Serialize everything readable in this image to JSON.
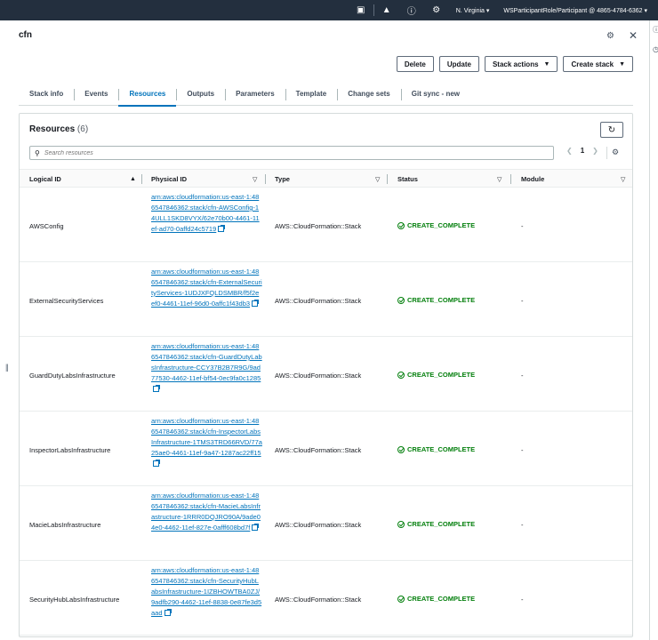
{
  "topbar": {
    "region": "N. Virginia",
    "account": "WSParticipantRole/Participant @ 4865-4784-6362"
  },
  "header": {
    "title": "cfn"
  },
  "actions": {
    "delete": "Delete",
    "update": "Update",
    "stack_actions": "Stack actions",
    "create_stack": "Create stack"
  },
  "tabs": [
    {
      "label": "Stack info",
      "active": false
    },
    {
      "label": "Events",
      "active": false
    },
    {
      "label": "Resources",
      "active": true
    },
    {
      "label": "Outputs",
      "active": false
    },
    {
      "label": "Parameters",
      "active": false
    },
    {
      "label": "Template",
      "active": false
    },
    {
      "label": "Change sets",
      "active": false
    },
    {
      "label": "Git sync - new",
      "active": false
    }
  ],
  "resources": {
    "title": "Resources",
    "count": "(6)",
    "search_placeholder": "Search resources",
    "page": "1",
    "columns": {
      "logical_id": "Logical ID",
      "physical_id": "Physical ID",
      "type": "Type",
      "status": "Status",
      "module": "Module"
    },
    "rows": [
      {
        "logical_id": "AWSConfig",
        "physical_id": "arn:aws:cloudformation:us-east-1:486547846362:stack/cfn-AWSConfig-14ULL1SKD8VYX/62e70b00-4461-11ef-ad70-0affd24c5719",
        "type": "AWS::CloudFormation::Stack",
        "status": "CREATE_COMPLETE",
        "module": "-"
      },
      {
        "logical_id": "ExternalSecurityServices",
        "physical_id": "arn:aws:cloudformation:us-east-1:486547846362:stack/cfn-ExternalSecurityServices-1UDJXFQLDSMBR/f5f2eef0-4461-11ef-96d0-0affc1f43db3",
        "type": "AWS::CloudFormation::Stack",
        "status": "CREATE_COMPLETE",
        "module": "-"
      },
      {
        "logical_id": "GuardDutyLabsInfrastructure",
        "physical_id": "arn:aws:cloudformation:us-east-1:486547846362:stack/cfn-GuardDutyLabsInfrastructure-CCY37B2B7R9G/9ad77530-4462-11ef-bf54-0ec9fa0c1285",
        "type": "AWS::CloudFormation::Stack",
        "status": "CREATE_COMPLETE",
        "module": "-"
      },
      {
        "logical_id": "InspectorLabsInfrastructure",
        "physical_id": "arn:aws:cloudformation:us-east-1:486547846362:stack/cfn-InspectorLabsInfrastructure-1TMS3TRD66RVD/77a25ae0-4461-11ef-9a47-1287ac22ff15",
        "type": "AWS::CloudFormation::Stack",
        "status": "CREATE_COMPLETE",
        "module": "-"
      },
      {
        "logical_id": "MacieLabsInfrastructure",
        "physical_id": "arn:aws:cloudformation:us-east-1:486547846362:stack/cfn-MacieLabsInfrastructure-1RRR0DQJRO90A/9ade04e0-4462-11ef-827e-0afff608bd7f",
        "type": "AWS::CloudFormation::Stack",
        "status": "CREATE_COMPLETE",
        "module": "-"
      },
      {
        "logical_id": "SecurityHubLabsInfrastructure",
        "physical_id": "arn:aws:cloudformation:us-east-1:486547846362:stack/cfn-SecurityHubLabsInfrastructure-1IZBHOWTBA0ZJ/9adfb290-4462-11ef-8838-0e87fe3d5aad",
        "type": "AWS::CloudFormation::Stack",
        "status": "CREATE_COMPLETE",
        "module": "-"
      }
    ]
  },
  "colors": {
    "topbar_bg": "#232f3e",
    "link": "#0073bb",
    "success": "#037f0c"
  }
}
